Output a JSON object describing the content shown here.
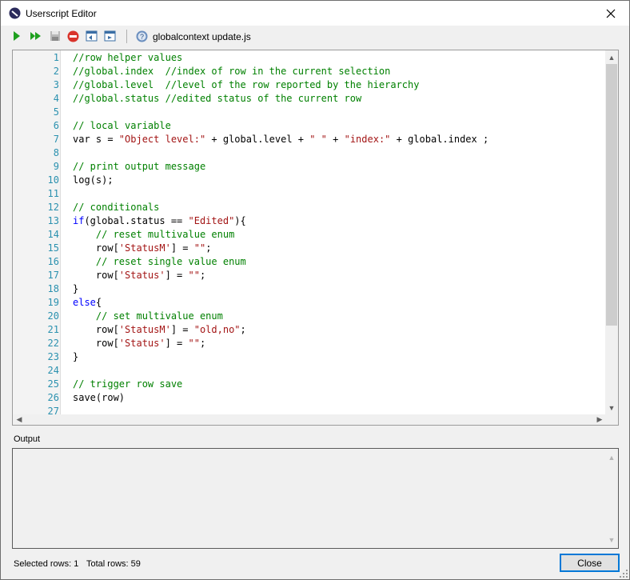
{
  "window": {
    "title": "Userscript Editor",
    "close_icon": "close-icon"
  },
  "toolbar": {
    "buttons": [
      {
        "name": "run-icon",
        "color": "#1fa01f"
      },
      {
        "name": "run-all-icon",
        "color": "#1fa01f"
      },
      {
        "name": "save-icon",
        "color": "#9a9a9a"
      },
      {
        "name": "stop-icon",
        "color": "#d9342b"
      },
      {
        "name": "open-in-window-icon",
        "color": "#3a6ea5"
      },
      {
        "name": "export-icon",
        "color": "#3a6ea5"
      },
      {
        "name": "help-icon",
        "color": "#3a6ea5"
      }
    ],
    "filename": "globalcontext update.js"
  },
  "editor": {
    "lines": [
      {
        "n": "1",
        "tokens": [
          {
            "t": "//row helper values",
            "c": "comment"
          }
        ]
      },
      {
        "n": "2",
        "tokens": [
          {
            "t": "//global.index  //index of row in the current selection",
            "c": "comment"
          }
        ]
      },
      {
        "n": "3",
        "tokens": [
          {
            "t": "//global.level  //level of the row reported by the hierarchy",
            "c": "comment"
          }
        ]
      },
      {
        "n": "4",
        "tokens": [
          {
            "t": "//global.status //edited status of the current row",
            "c": "comment"
          }
        ]
      },
      {
        "n": "5",
        "tokens": []
      },
      {
        "n": "6",
        "tokens": [
          {
            "t": "// local variable",
            "c": "comment"
          }
        ]
      },
      {
        "n": "7",
        "tokens": [
          {
            "t": "var s = ",
            "c": "plain"
          },
          {
            "t": "\"Object level:\"",
            "c": "string"
          },
          {
            "t": " + global.level + ",
            "c": "plain"
          },
          {
            "t": "\" \"",
            "c": "string"
          },
          {
            "t": " + ",
            "c": "plain"
          },
          {
            "t": "\"index:\"",
            "c": "string"
          },
          {
            "t": " + global.index ;",
            "c": "plain"
          }
        ]
      },
      {
        "n": "8",
        "tokens": []
      },
      {
        "n": "9",
        "tokens": [
          {
            "t": "// print output message",
            "c": "comment"
          }
        ]
      },
      {
        "n": "10",
        "tokens": [
          {
            "t": "log(s);",
            "c": "plain"
          }
        ]
      },
      {
        "n": "11",
        "tokens": []
      },
      {
        "n": "12",
        "tokens": [
          {
            "t": "// conditionals",
            "c": "comment"
          }
        ]
      },
      {
        "n": "13",
        "tokens": [
          {
            "t": "if",
            "c": "keyword"
          },
          {
            "t": "(global.status == ",
            "c": "plain"
          },
          {
            "t": "\"Edited\"",
            "c": "string"
          },
          {
            "t": "){",
            "c": "plain"
          }
        ]
      },
      {
        "n": "14",
        "tokens": [
          {
            "t": "    // reset multivalue enum",
            "c": "comment"
          }
        ]
      },
      {
        "n": "15",
        "tokens": [
          {
            "t": "    row[",
            "c": "plain"
          },
          {
            "t": "'StatusM'",
            "c": "string"
          },
          {
            "t": "] = ",
            "c": "plain"
          },
          {
            "t": "\"\"",
            "c": "string"
          },
          {
            "t": ";",
            "c": "plain"
          }
        ]
      },
      {
        "n": "16",
        "tokens": [
          {
            "t": "    // reset single value enum",
            "c": "comment"
          }
        ]
      },
      {
        "n": "17",
        "tokens": [
          {
            "t": "    row[",
            "c": "plain"
          },
          {
            "t": "'Status'",
            "c": "string"
          },
          {
            "t": "] = ",
            "c": "plain"
          },
          {
            "t": "\"\"",
            "c": "string"
          },
          {
            "t": ";",
            "c": "plain"
          }
        ]
      },
      {
        "n": "18",
        "tokens": [
          {
            "t": "}",
            "c": "plain"
          }
        ]
      },
      {
        "n": "19",
        "tokens": [
          {
            "t": "else",
            "c": "keyword"
          },
          {
            "t": "{",
            "c": "plain"
          }
        ]
      },
      {
        "n": "20",
        "tokens": [
          {
            "t": "    // set multivalue enum",
            "c": "comment"
          }
        ]
      },
      {
        "n": "21",
        "tokens": [
          {
            "t": "    row[",
            "c": "plain"
          },
          {
            "t": "'StatusM'",
            "c": "string"
          },
          {
            "t": "] = ",
            "c": "plain"
          },
          {
            "t": "\"old,no\"",
            "c": "string"
          },
          {
            "t": ";",
            "c": "plain"
          }
        ]
      },
      {
        "n": "22",
        "tokens": [
          {
            "t": "    row[",
            "c": "plain"
          },
          {
            "t": "'Status'",
            "c": "string"
          },
          {
            "t": "] = ",
            "c": "plain"
          },
          {
            "t": "\"\"",
            "c": "string"
          },
          {
            "t": ";",
            "c": "plain"
          }
        ]
      },
      {
        "n": "23",
        "tokens": [
          {
            "t": "}",
            "c": "plain"
          }
        ]
      },
      {
        "n": "24",
        "tokens": []
      },
      {
        "n": "25",
        "tokens": [
          {
            "t": "// trigger row save",
            "c": "comment"
          }
        ]
      },
      {
        "n": "26",
        "tokens": [
          {
            "t": "save(row)",
            "c": "plain"
          }
        ]
      },
      {
        "n": "27",
        "tokens": []
      }
    ]
  },
  "output": {
    "label": "Output",
    "text": ""
  },
  "status": {
    "selected_rows": "Selected rows: 1",
    "total_rows": "Total rows: 59"
  },
  "close_button": {
    "label": "Close"
  }
}
